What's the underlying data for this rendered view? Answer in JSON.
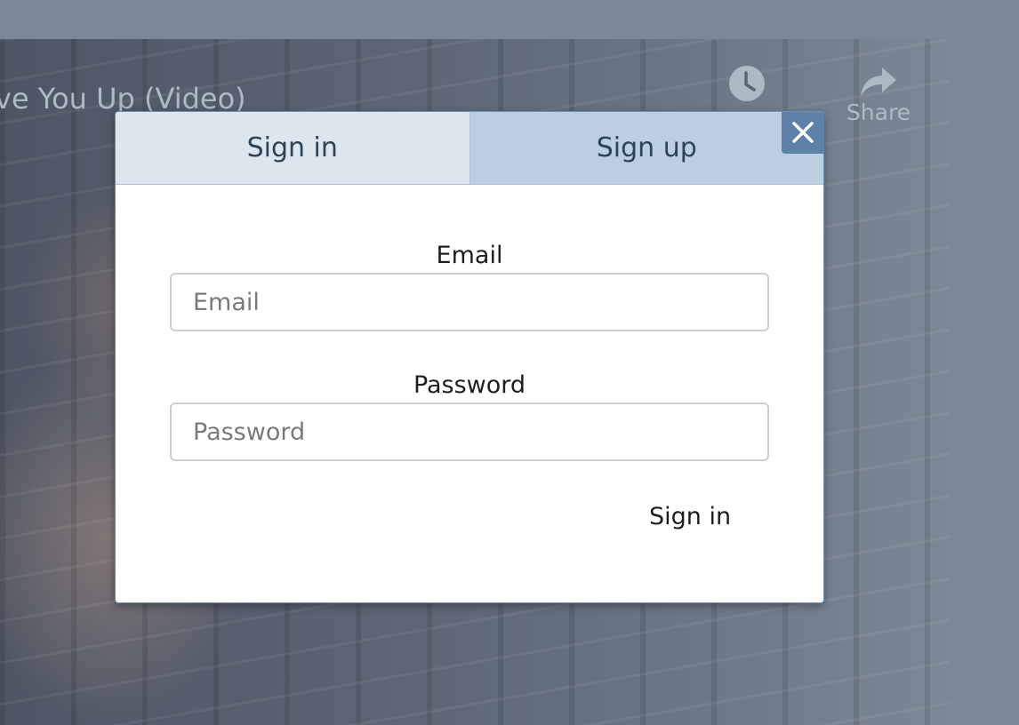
{
  "background": {
    "video_title": "ve You Up (Video)",
    "watch_later_icon": "clock-icon",
    "share_icon": "share-arrow-icon",
    "share_label": "Share"
  },
  "modal": {
    "tabs": [
      {
        "label": "Sign in",
        "active": true
      },
      {
        "label": "Sign up",
        "active": false
      }
    ],
    "close_icon": "close-icon",
    "email": {
      "label": "Email",
      "placeholder": "Email",
      "value": ""
    },
    "password": {
      "label": "Password",
      "placeholder": "Password",
      "value": ""
    },
    "submit_label": "Sign in"
  },
  "colors": {
    "close_button": "#5d81a7",
    "active_tab": "#dde5ee",
    "inactive_tab": "#bccfe0",
    "tab_text": "#2e4356",
    "overlay": "#7b8898"
  }
}
